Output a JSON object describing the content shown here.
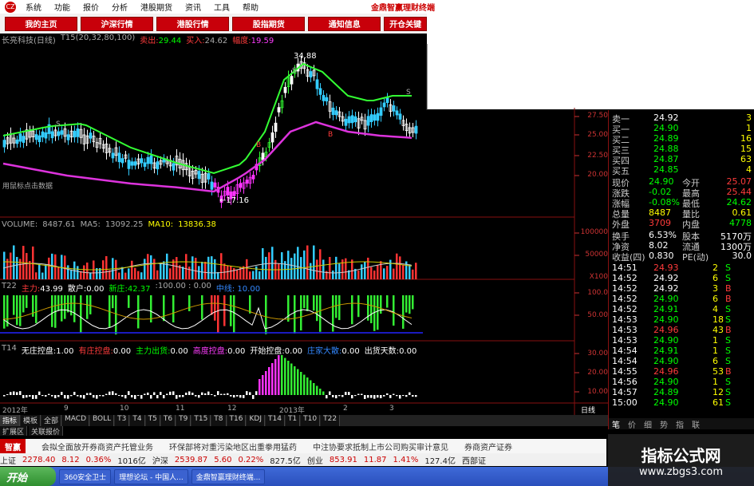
{
  "menubar": {
    "logo": "CZ",
    "items": [
      "系统",
      "功能",
      "报价",
      "分析",
      "港股期货",
      "资讯",
      "工具",
      "帮助"
    ],
    "title": "金鼎智赢理财终端"
  },
  "navbar": {
    "buttons": [
      "我的主页",
      "沪深行情",
      "港股行情",
      "股指期货",
      "通知信息",
      "开仓关键"
    ]
  },
  "stock_info": {
    "name": "长亮科技(日线)",
    "indicator": "T15(20,32,80,100)",
    "sell_label": "卖出:",
    "sell_value": "29.44",
    "buy_label": "买入:",
    "buy_value": "24.62",
    "range_label": "幅度:",
    "range_value": "19.59"
  },
  "price_chart": {
    "peak_label": "34.88",
    "trough_label": "←17.16",
    "future_label": "用鼠标点击数据",
    "axis": [
      "27.50",
      "25.00",
      "22.50",
      "20.00"
    ],
    "signal_s": "S",
    "signal_b": "B"
  },
  "volume": {
    "label": "VOLUME:",
    "value": "8487.61",
    "ma5_label": "MA5:",
    "ma5": "13092.25",
    "ma10_label": "MA10:",
    "ma10": "13836.38",
    "axis": [
      "100000",
      "50000",
      "X100"
    ]
  },
  "t22": {
    "name": "T22",
    "main_label": "主力:",
    "main_value": "43.99",
    "retail_label": "散户:",
    "retail_value": "0.00",
    "new_label": "新庄:",
    "new_value": "42.37",
    "extra": ":100.00 : 0.00",
    "extra2": "中线: 10.00",
    "axis": [
      "100.0",
      "50.00"
    ]
  },
  "t14": {
    "name": "T14",
    "items": [
      {
        "label": "无庄控盘:",
        "value": "1.00",
        "color": "#fff"
      },
      {
        "label": "有庄控盘:",
        "value": "0.00",
        "color": "#ff3b3b"
      },
      {
        "label": "主力出货:",
        "value": "0.00",
        "color": "#0f0"
      },
      {
        "label": "高度控盘:",
        "value": "0.00",
        "color": "#ff3cff"
      },
      {
        "label": "开始控盘:",
        "value": "0.00",
        "color": "#fff"
      },
      {
        "label": "庄家大散:",
        "value": "0.00",
        "color": "#38f"
      },
      {
        "label": "出货天数:",
        "value": "0.00",
        "color": "#fff"
      }
    ],
    "axis": [
      "30.00",
      "20.00",
      "10.00"
    ]
  },
  "time_axis": {
    "labels": [
      "2012年",
      "9",
      "10",
      "11",
      "12",
      "2013年",
      "2",
      "3"
    ],
    "period": "日线"
  },
  "bottom_tabs": [
    "指标",
    "模板",
    "全部",
    "MACD",
    "BOLL",
    "T3",
    "T4",
    "T5",
    "T6",
    "T9",
    "T15",
    "T8",
    "T16",
    "KDJ",
    "T14",
    "T1",
    "T10",
    "T22"
  ],
  "ext_tabs": [
    "扩展区",
    "关联报价"
  ],
  "quote": {
    "sell1_label": "卖一",
    "sell1_price": "24.92",
    "sell1_vol": "3",
    "buy_label_prefix": "买",
    "buys": [
      {
        "label": "买一",
        "price": "24.90",
        "vol": "1"
      },
      {
        "label": "买二",
        "price": "24.89",
        "vol": "16"
      },
      {
        "label": "买三",
        "price": "24.88",
        "vol": "15"
      },
      {
        "label": "买四",
        "price": "24.87",
        "vol": "63"
      },
      {
        "label": "买五",
        "price": "24.85",
        "vol": "4"
      }
    ],
    "stats": [
      {
        "l1": "现价",
        "v1": "24.90",
        "l2": "今开",
        "v2": "25.07",
        "c1": "#0f0",
        "c2": "#ff3b3b"
      },
      {
        "l1": "涨跌",
        "v1": "-0.02",
        "l2": "最高",
        "v2": "25.44",
        "c1": "#0f0",
        "c2": "#ff3b3b"
      },
      {
        "l1": "涨幅",
        "v1": "-0.08%",
        "l2": "最低",
        "v2": "24.62",
        "c1": "#0f0",
        "c2": "#0f0"
      },
      {
        "l1": "总量",
        "v1": "8487",
        "l2": "量比",
        "v2": "0.61",
        "c1": "#ff0",
        "c2": "#ff0"
      },
      {
        "l1": "外盘",
        "v1": "3709",
        "l2": "内盘",
        "v2": "4778",
        "c1": "#ff3b3b",
        "c2": "#0f0"
      }
    ],
    "fund": [
      {
        "l1": "换手",
        "v1": "6.53%",
        "l2": "股本",
        "v2": "5170万"
      },
      {
        "l1": "净资",
        "v1": "8.02",
        "l2": "流通",
        "v2": "1300万"
      },
      {
        "l1": "收益(四)",
        "v1": "0.830",
        "l2": "PE(动)",
        "v2": "30.0"
      }
    ],
    "ticks": [
      {
        "t": "14:51",
        "p": "24.93",
        "v": "2",
        "s": "S",
        "pc": "#ff3b3b"
      },
      {
        "t": "14:52",
        "p": "24.92",
        "v": "6",
        "s": "S",
        "pc": "#fff"
      },
      {
        "t": "14:52",
        "p": "24.92",
        "v": "3",
        "s": "B",
        "pc": "#fff"
      },
      {
        "t": "14:52",
        "p": "24.90",
        "v": "6",
        "s": "B",
        "pc": "#0f0"
      },
      {
        "t": "14:52",
        "p": "24.91",
        "v": "4",
        "s": "S",
        "pc": "#0f0"
      },
      {
        "t": "14:53",
        "p": "24.90",
        "v": "18",
        "s": "S",
        "pc": "#0f0"
      },
      {
        "t": "14:53",
        "p": "24.96",
        "v": "43",
        "s": "B",
        "pc": "#ff3b3b"
      },
      {
        "t": "14:53",
        "p": "24.90",
        "v": "1",
        "s": "S",
        "pc": "#0f0"
      },
      {
        "t": "14:54",
        "p": "24.91",
        "v": "1",
        "s": "S",
        "pc": "#0f0"
      },
      {
        "t": "14:54",
        "p": "24.90",
        "v": "6",
        "s": "S",
        "pc": "#0f0"
      },
      {
        "t": "14:55",
        "p": "24.96",
        "v": "53",
        "s": "B",
        "pc": "#ff3b3b"
      },
      {
        "t": "14:56",
        "p": "24.90",
        "v": "1",
        "s": "S",
        "pc": "#0f0"
      },
      {
        "t": "14:57",
        "p": "24.89",
        "v": "12",
        "s": "S",
        "pc": "#0f0"
      },
      {
        "t": "15:00",
        "p": "24.90",
        "v": "61",
        "s": "S",
        "pc": "#0f0"
      }
    ],
    "tabs": [
      "笔",
      "价",
      "细",
      "势",
      "指",
      "联"
    ]
  },
  "news": {
    "tag": "智赢",
    "items": [
      "会拟全面放开券商资产托管业务",
      "环保部将对重污染地区出重拳用猛药",
      "中注协要求抵制上市公司购买审计意见",
      "券商资产证券"
    ]
  },
  "indexbar": {
    "items": [
      {
        "name": "上证",
        "value": "2278.40",
        "chg": "8.12",
        "pct": "0.36%",
        "amt": "1016亿"
      },
      {
        "name": "沪深",
        "value": "2539.87",
        "chg": "5.60",
        "pct": "0.22%",
        "amt": "827.5亿"
      },
      {
        "name": "创业",
        "value": "853.91",
        "chg": "11.87",
        "pct": "1.41%",
        "amt": "127.4亿"
      }
    ],
    "right": "西部证"
  },
  "taskbar": {
    "start": "开始",
    "items": [
      "360安全卫士",
      "理想论坛 - 中国人...",
      "金鼎智赢理财终端..."
    ]
  },
  "watermark": {
    "line1": "指标公式网",
    "line2": "www.zbgs3.com"
  }
}
